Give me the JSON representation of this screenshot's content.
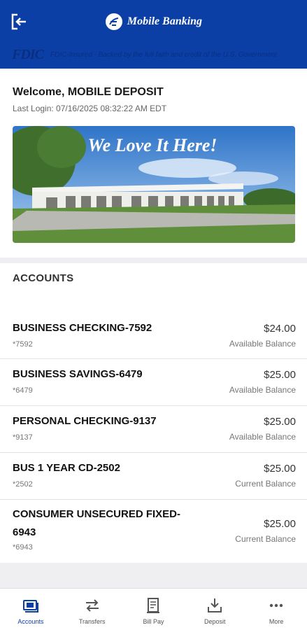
{
  "header": {
    "brand": "Mobile Banking",
    "fdic_logo": "FDIC",
    "fdic_text": "FDIC-Insured - Backed by the full faith and credit of the U.S. Government"
  },
  "welcome": {
    "title": "Welcome, MOBILE DEPOSIT",
    "last_login": "Last Login: 07/16/2025 08:32:22 AM EDT",
    "banner_text": "We Love It Here!"
  },
  "accounts": {
    "title": "ACCOUNTS",
    "items": [
      {
        "name": "BUSINESS CHECKING-7592",
        "mask": "*7592",
        "amount": "$24.00",
        "label": "Available Balance"
      },
      {
        "name": "BUSINESS SAVINGS-6479",
        "mask": "*6479",
        "amount": "$25.00",
        "label": "Available Balance"
      },
      {
        "name": "PERSONAL CHECKING-9137",
        "mask": "*9137",
        "amount": "$25.00",
        "label": "Available Balance"
      },
      {
        "name": "BUS 1 YEAR CD-2502",
        "mask": "*2502",
        "amount": "$25.00",
        "label": "Current Balance"
      },
      {
        "name": "CONSUMER UNSECURED FIXED-6943",
        "mask": "*6943",
        "amount": "$25.00",
        "label": "Current Balance"
      }
    ]
  },
  "tabs": [
    {
      "label": "Accounts",
      "icon": "accounts-icon",
      "active": true
    },
    {
      "label": "Transfers",
      "icon": "transfer-arrows-icon"
    },
    {
      "label": "Bill Pay",
      "icon": "bill-icon"
    },
    {
      "label": "Deposit",
      "icon": "deposit-icon"
    },
    {
      "label": "More",
      "icon": "more-dots-icon"
    }
  ],
  "colors": {
    "primary": "#0b3fa6",
    "fdic": "#0a2f80"
  }
}
